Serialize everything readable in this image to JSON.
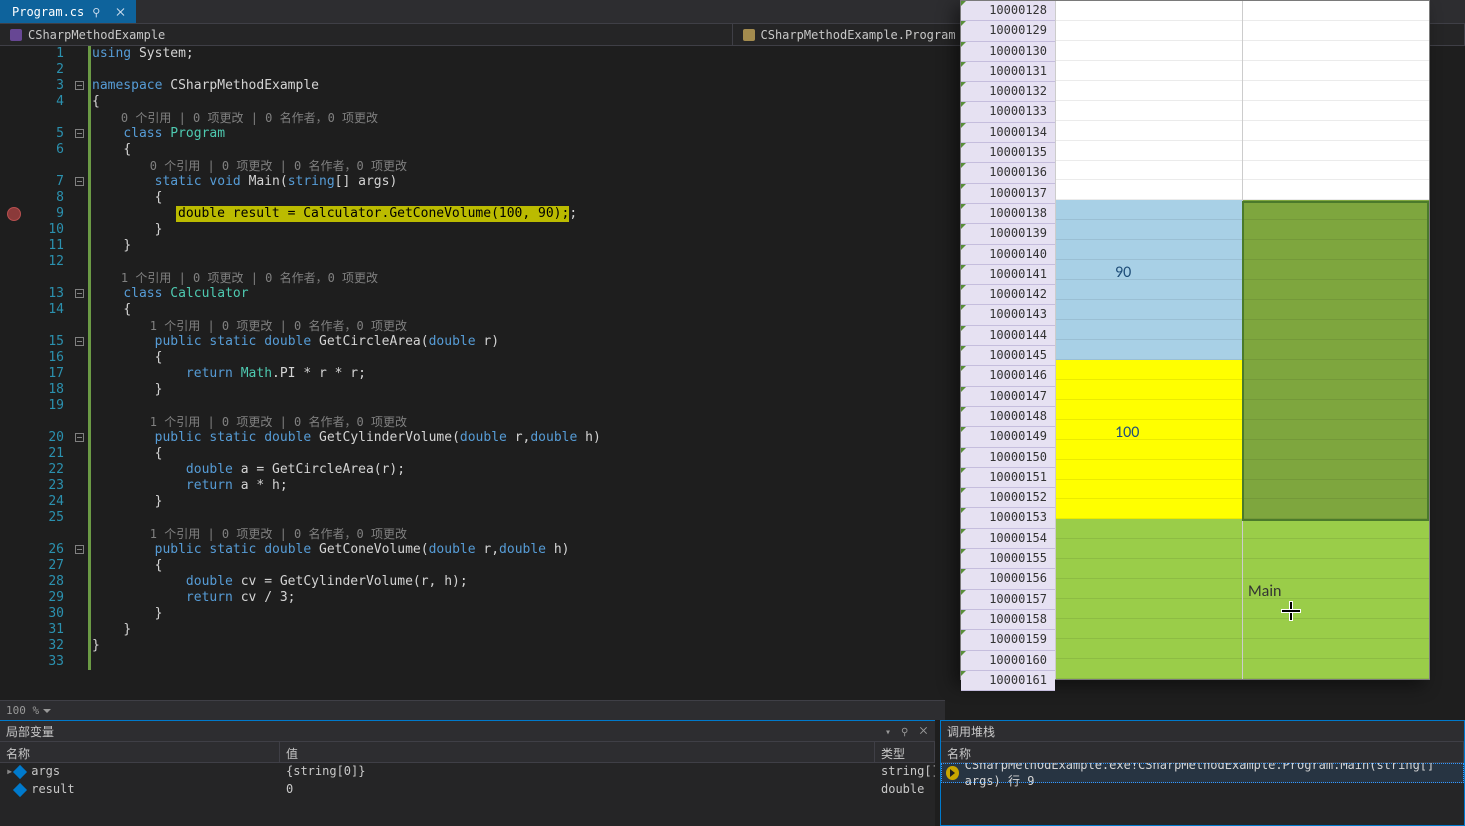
{
  "tab": {
    "title": "Program.cs"
  },
  "nav": {
    "namespace": "CSharpMethodExample",
    "class": "CSharpMethodExample.Program"
  },
  "editor": {
    "codelens_template": "{refs} 个引用 | 0 项更改 | 0 名作者，0 项更改",
    "lines": [
      {
        "n": 1,
        "html": "<span class='c-kw'>using</span> <span class='c-text'>System;</span>"
      },
      {
        "n": 2,
        "html": ""
      },
      {
        "n": 3,
        "fold": true,
        "html": "<span class='c-kw'>namespace</span> <span class='c-text'>CSharpMethodExample</span>"
      },
      {
        "n": 4,
        "html": "<span class='c-text'>{</span>"
      },
      {
        "n": null,
        "codelens": 0,
        "indent": 4
      },
      {
        "n": 5,
        "fold": true,
        "html": "    <span class='c-kw'>class</span> <span class='c-type'>Program</span>"
      },
      {
        "n": 6,
        "html": "    <span class='c-text'>{</span>"
      },
      {
        "n": null,
        "codelens": 0,
        "indent": 8
      },
      {
        "n": 7,
        "fold": true,
        "html": "        <span class='c-kw'>static</span> <span class='c-kw'>void</span> <span class='c-text'>Main(</span><span class='c-kw'>string</span><span class='c-text'>[] args)</span>"
      },
      {
        "n": 8,
        "html": "        <span class='c-text'>{</span>"
      },
      {
        "n": 9,
        "current": true,
        "html": "            <span class='c-kw'>double</span> result = Calculator.GetConeVolume(100, 90);"
      },
      {
        "n": 10,
        "html": "        <span class='c-text'>}</span>"
      },
      {
        "n": 11,
        "html": "    <span class='c-text'>}</span>"
      },
      {
        "n": 12,
        "html": ""
      },
      {
        "n": null,
        "codelens": 1,
        "indent": 4
      },
      {
        "n": 13,
        "fold": true,
        "html": "    <span class='c-kw'>class</span> <span class='c-type'>Calculator</span>"
      },
      {
        "n": 14,
        "html": "    <span class='c-text'>{</span>"
      },
      {
        "n": null,
        "codelens": 1,
        "indent": 8
      },
      {
        "n": 15,
        "fold": true,
        "html": "        <span class='c-kw'>public</span> <span class='c-kw'>static</span> <span class='c-kw'>double</span> <span class='c-text'>GetCircleArea(</span><span class='c-kw'>double</span> <span class='c-text'>r)</span>"
      },
      {
        "n": 16,
        "html": "        <span class='c-text'>{</span>"
      },
      {
        "n": 17,
        "html": "            <span class='c-kw'>return</span> <span class='c-type'>Math</span><span class='c-text'>.PI * r * r;</span>"
      },
      {
        "n": 18,
        "html": "        <span class='c-text'>}</span>"
      },
      {
        "n": 19,
        "html": ""
      },
      {
        "n": null,
        "codelens": 1,
        "indent": 8
      },
      {
        "n": 20,
        "fold": true,
        "html": "        <span class='c-kw'>public</span> <span class='c-kw'>static</span> <span class='c-kw'>double</span> <span class='c-text'>GetCylinderVolume(</span><span class='c-kw'>double</span> <span class='c-text'>r,</span><span class='c-kw'>double</span> <span class='c-text'>h)</span>"
      },
      {
        "n": 21,
        "html": "        <span class='c-text'>{</span>"
      },
      {
        "n": 22,
        "html": "            <span class='c-kw'>double</span> <span class='c-text'>a = GetCircleArea(r);</span>"
      },
      {
        "n": 23,
        "html": "            <span class='c-kw'>return</span> <span class='c-text'>a * h;</span>"
      },
      {
        "n": 24,
        "html": "        <span class='c-text'>}</span>"
      },
      {
        "n": 25,
        "html": ""
      },
      {
        "n": null,
        "codelens": 1,
        "indent": 8
      },
      {
        "n": 26,
        "fold": true,
        "html": "        <span class='c-kw'>public</span> <span class='c-kw'>static</span> <span class='c-kw'>double</span> <span class='c-text'>GetConeVolume(</span><span class='c-kw'>double</span> <span class='c-text'>r,</span><span class='c-kw'>double</span> <span class='c-text'>h)</span>"
      },
      {
        "n": 27,
        "html": "        <span class='c-text'>{</span>"
      },
      {
        "n": 28,
        "html": "            <span class='c-kw'>double</span> <span class='c-text'>cv = GetCylinderVolume(r, h);</span>"
      },
      {
        "n": 29,
        "html": "            <span class='c-kw'>return</span> <span class='c-text'>cv / 3;</span>"
      },
      {
        "n": 30,
        "html": "        <span class='c-text'>}</span>"
      },
      {
        "n": 31,
        "html": "    <span class='c-text'>}</span>"
      },
      {
        "n": 32,
        "html": "<span class='c-text'>}</span>"
      },
      {
        "n": 33,
        "html": ""
      }
    ],
    "current_stmt_text": "double result = Calculator.GetConeVolume(100, 90);",
    "breakpoint_line": 9
  },
  "zoom": {
    "value": "100 %"
  },
  "locals": {
    "title": "局部变量",
    "cols": {
      "name": "名称",
      "value": "值",
      "type": "类型"
    },
    "rows": [
      {
        "name": "args",
        "value": "{string[0]}",
        "type": "string[]",
        "expandable": true
      },
      {
        "name": "result",
        "value": "0",
        "type": "double",
        "expandable": false
      }
    ]
  },
  "callstack": {
    "title": "调用堆栈",
    "col": "名称",
    "frames": [
      "CSharpMethodExample.exe!CSharpMethodExample.Program.Main(string[] args) 行 9"
    ]
  },
  "overlay": {
    "row_start": 10000128,
    "row_end": 10000161,
    "regions_col1": [
      {
        "from": 10000128,
        "to": 10000137,
        "color": "#ffffff"
      },
      {
        "from": 10000138,
        "to": 10000145,
        "color": "#a8d0e6",
        "label": "90"
      },
      {
        "from": 10000146,
        "to": 10000153,
        "color": "#ffff00",
        "label": "100"
      },
      {
        "from": 10000154,
        "to": 10000161,
        "color": "#9acd49"
      }
    ],
    "regions_col2": [
      {
        "from": 10000128,
        "to": 10000137,
        "color": "#ffffff"
      },
      {
        "from": 10000138,
        "to": 10000153,
        "color": "#7ea63e",
        "border": true
      },
      {
        "from": 10000154,
        "to": 10000161,
        "color": "#9acd49",
        "label": "Main",
        "label_row": 10000157
      }
    ],
    "cursor_row": 10000158
  }
}
